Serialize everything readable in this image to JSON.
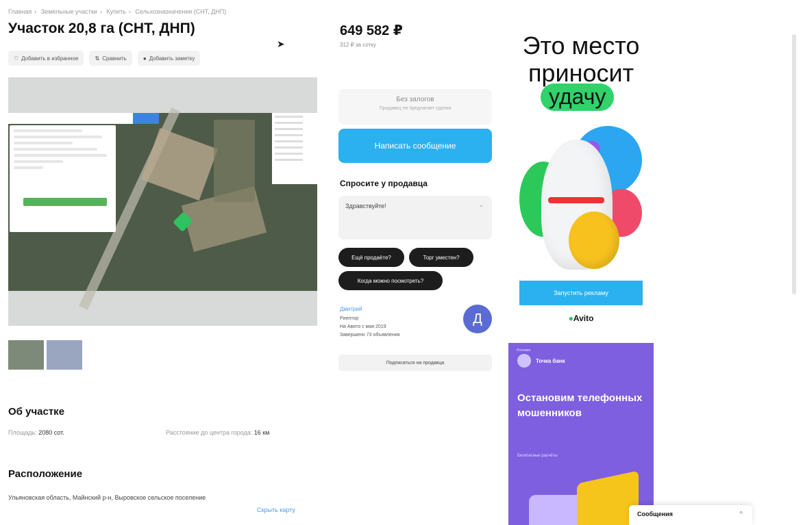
{
  "breadcrumb": [
    "Главная",
    "Земельные участки",
    "Купить",
    "Сельхозназначения (СНТ, ДНП)"
  ],
  "title": "Участок 20,8 га (СНТ, ДНП)",
  "actions": {
    "favorite": "Добавить в избранное",
    "compare": "Сравнить",
    "note": "Добавить заметку"
  },
  "price": {
    "value": "649 582 ₽",
    "sub": "312 ₽ за сотку"
  },
  "deposit": {
    "title": "Без залогов",
    "sub": "Продавец не предлагает сделки"
  },
  "write_button": "Написать сообщение",
  "ask": {
    "heading": "Спросите у продавца",
    "input_value": "Здравствуйте!",
    "chips": [
      "Ещё продаёте?",
      "Торг уместен?",
      "Когда можно посмотреть?"
    ]
  },
  "seller": {
    "name": "Дмитрий",
    "role": "Риелтор",
    "since": "На Авито с мая 2019",
    "completed": "Завершено 73 объявления",
    "avatar_letter": "Д",
    "subscribe": "Подписаться на продавца"
  },
  "about": {
    "heading": "Об участке",
    "area_label": "Площадь:",
    "area_value": "2080 сот.",
    "distance_label": "Расстояние до центра города:",
    "distance_value": "16 км"
  },
  "location": {
    "heading": "Расположение",
    "address": "Ульяновская область, Майнский р-н, Выровское сельское поселение",
    "map_link": "Скрыть карту"
  },
  "ad_avito": {
    "line1": "Это место",
    "line2": "приносит",
    "highlight": "удачу",
    "button": "Запустить рекламу",
    "logo": "Avito"
  },
  "ad_bank": {
    "label": "Реклама",
    "brand": "Точка банк",
    "headline": "Остановим телефонных мошенников",
    "sub": "Безопасные расчёты"
  },
  "messages": {
    "label": "Сообщения",
    "chevron": "^"
  },
  "icons": {
    "heart": "♡",
    "compare": "⇅",
    "note": "●",
    "cursor": "➤"
  },
  "colors": {
    "accent": "#2bb0f0",
    "chip": "#1d1d1d",
    "avatar": "#5b6bd4",
    "luck": "#2fd36a"
  }
}
